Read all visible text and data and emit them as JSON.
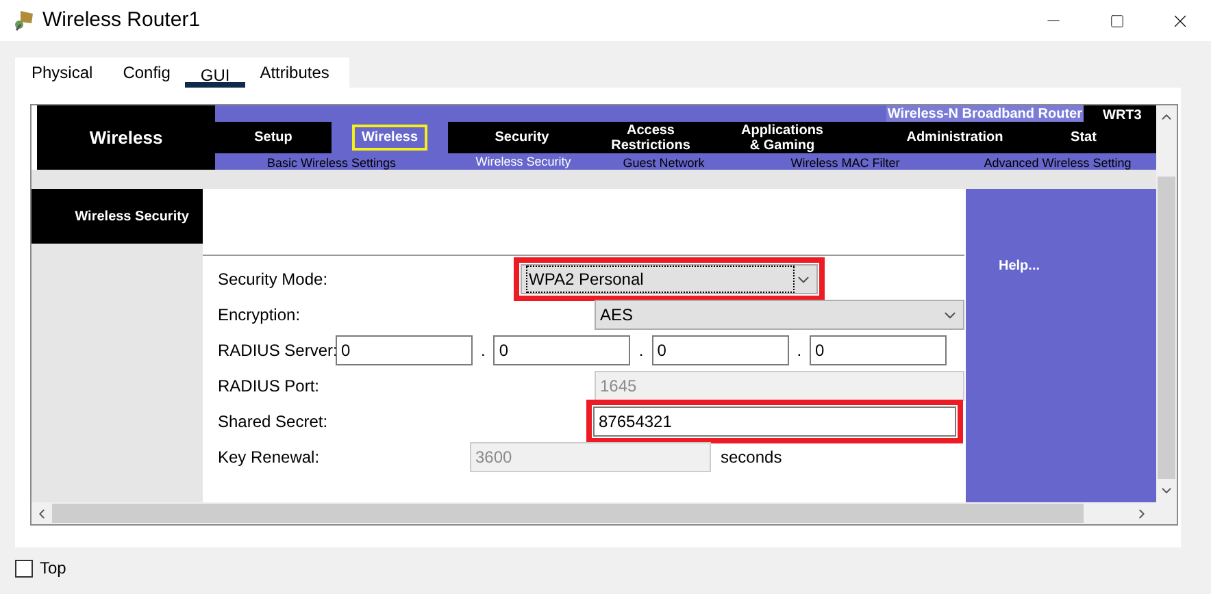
{
  "window": {
    "title": "Wireless Router1"
  },
  "tabs": [
    {
      "label": "Physical",
      "selected": false
    },
    {
      "label": "Config",
      "selected": false
    },
    {
      "label": "GUI",
      "selected": true
    },
    {
      "label": "Attributes",
      "selected": false
    }
  ],
  "router": {
    "section": "Wireless",
    "product": "Wireless-N Broadband Router",
    "model": "WRT3",
    "menu": [
      {
        "label": "Setup",
        "selected": false
      },
      {
        "label": "Wireless",
        "selected": true
      },
      {
        "label": "Security",
        "selected": false
      },
      {
        "label": "Access\nRestrictions",
        "selected": false
      },
      {
        "label": "Applications\n& Gaming",
        "selected": false
      },
      {
        "label": "Administration",
        "selected": false
      },
      {
        "label": "Stat",
        "selected": false
      }
    ],
    "submenu": [
      {
        "label": "Basic Wireless Settings",
        "selected": false
      },
      {
        "label": "Wireless Security",
        "selected": true
      },
      {
        "label": "Guest Network",
        "selected": false
      },
      {
        "label": "Wireless MAC Filter",
        "selected": false
      },
      {
        "label": "Advanced Wireless Setting",
        "selected": false
      }
    ],
    "page_title": "Wireless Security",
    "fields": [
      {
        "label": "Security Mode:",
        "kind": "select",
        "value": "WPA2 Personal",
        "highlighted": true,
        "disabled": false
      },
      {
        "label": "Encryption:",
        "kind": "select",
        "value": "AES",
        "highlighted": false,
        "disabled": false
      },
      {
        "label": "RADIUS Server:",
        "kind": "ip",
        "octets": [
          "0",
          "0",
          "0",
          "0"
        ],
        "separator": ".",
        "highlighted": false,
        "disabled": false
      },
      {
        "label": "RADIUS Port:",
        "kind": "input",
        "value": "1645",
        "highlighted": false,
        "disabled": true
      },
      {
        "label": "Shared Secret:",
        "kind": "input",
        "value": "87654321",
        "highlighted": true,
        "disabled": false
      },
      {
        "label": "Key Renewal:",
        "kind": "input",
        "value": "3600",
        "unit": "seconds",
        "highlighted": false,
        "disabled": true
      }
    ],
    "help": "Help..."
  },
  "top_checkbox": {
    "label": "Top",
    "checked": false
  }
}
